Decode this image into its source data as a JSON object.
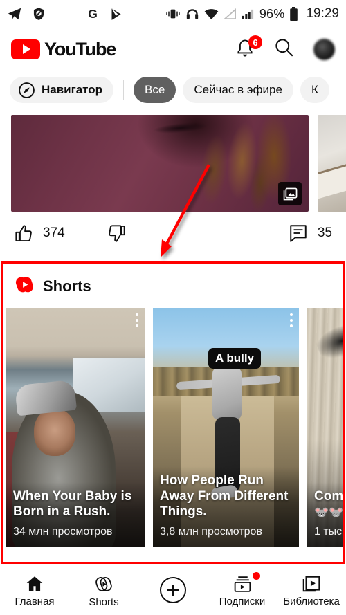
{
  "status_bar": {
    "left_icons": [
      "telegram-icon",
      "shield-block-icon",
      "google-icon",
      "play-store-icon"
    ],
    "vibrate_icon": "vibrate-icon",
    "headphones_icon": "headphones-icon",
    "wifi_icon": "wifi-icon",
    "signal_icon": "signal-triangle-icon",
    "cell_icon": "cell-bars-icon",
    "battery_percent": "96%",
    "battery_icon": "battery-full-icon",
    "time": "19:29"
  },
  "app_header": {
    "logo_text": "YouTube",
    "notifications_badge": "6",
    "notifications_icon": "bell-icon",
    "search_icon": "search-icon",
    "avatar": "account-avatar"
  },
  "chips": {
    "navigator": {
      "label": "Навигатор",
      "icon": "compass-icon"
    },
    "items": [
      {
        "label": "Все",
        "selected": true
      },
      {
        "label": "Сейчас в эфире",
        "selected": false
      },
      {
        "label": "К",
        "selected": false
      }
    ]
  },
  "post": {
    "gallery_icon": "gallery-images-icon",
    "likes": "374",
    "like_icon": "thumbs-up-icon",
    "dislike_icon": "thumbs-down-icon",
    "comments": "35",
    "comment_icon": "comment-icon"
  },
  "shorts": {
    "section_title": "Shorts",
    "section_icon": "shorts-logo-icon",
    "highlight_color": "#ff0000",
    "cards": [
      {
        "title": "When Your Baby is Born in a Rush.",
        "views": "34 млн просмотров",
        "menu_icon": "more-vertical-icon"
      },
      {
        "title": "How People Run Away From Different Things.",
        "views": "3,8 млн просмотров",
        "caption_badge": "A bully",
        "menu_icon": "more-vertical-icon"
      },
      {
        "title": "Com",
        "views": "1 тыс",
        "emoji": "🐭🐭"
      }
    ]
  },
  "bottom_nav": {
    "items": [
      {
        "label": "Главная",
        "icon": "home-icon",
        "active": true
      },
      {
        "label": "Shorts",
        "icon": "shorts-icon",
        "active": false
      },
      {
        "label": "",
        "icon": "plus-create-icon",
        "active": false
      },
      {
        "label": "Подписки",
        "icon": "subscriptions-icon",
        "active": false,
        "badge_dot": true
      },
      {
        "label": "Библиотека",
        "icon": "library-icon",
        "active": false
      }
    ]
  }
}
